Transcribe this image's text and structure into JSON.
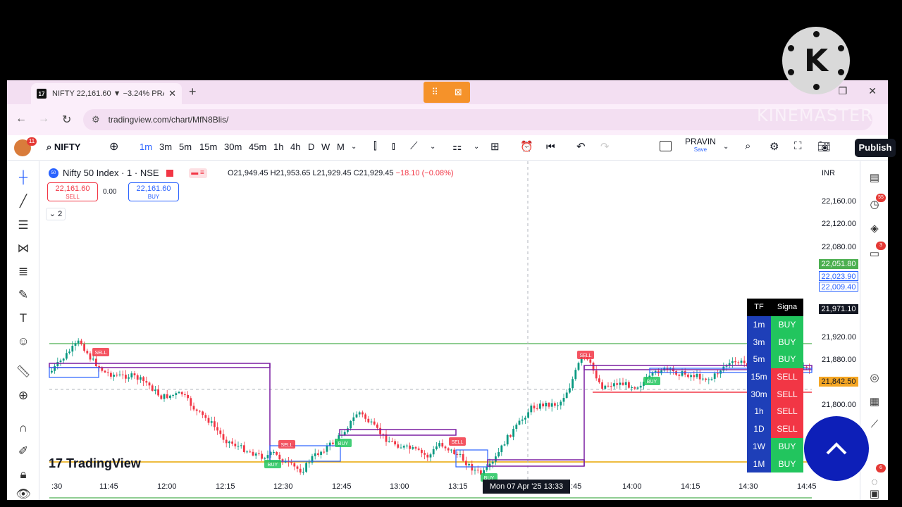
{
  "browser": {
    "tab_title": "NIFTY 22,161.60 ▼ −3.24% PRA",
    "url": "tradingview.com/chart/MfN8Blis/",
    "tab_close": "✕",
    "new_tab": "+",
    "win_restore": "❐",
    "win_close": "✕"
  },
  "overlay": {
    "logo_letter": "K",
    "watermark": "KINEMASTER"
  },
  "header": {
    "symbol": "NIFTY",
    "timeframes": [
      "1m",
      "3m",
      "5m",
      "15m",
      "30m",
      "45m",
      "1h",
      "4h",
      "D",
      "W",
      "M"
    ],
    "active_timeframe": "1m",
    "layout_name": "PRAVIN",
    "layout_sub": "Save",
    "publish_label": "Publish"
  },
  "legend": {
    "title": "Nifty 50 Index · 1 · NSE",
    "symbol_badge": "50",
    "o": "O21,949.45",
    "h": "H21,953.65",
    "l": "L21,929.45",
    "c": "C21,929.45",
    "chg": "−18.10 (−0.08%)",
    "sell_price": "22,161.60",
    "sell_label": "SELL",
    "buy_price": "22,161.60",
    "buy_label": "BUY",
    "spread": "0.00",
    "indicator_count": "2"
  },
  "price_axis": {
    "currency": "INR",
    "labels": [
      "22,160.00",
      "22,120.00",
      "22,080.00",
      "21,920.00",
      "21,880.00",
      "21,800.00"
    ],
    "tags": [
      {
        "text": "22,051.80",
        "bg": "#4caf50",
        "fg": "#ffffff"
      },
      {
        "text": "22,023.90",
        "bg": "#ffffff",
        "fg": "#2962ff"
      },
      {
        "text": "22,009.40",
        "bg": "#ffffff",
        "fg": "#2962ff"
      },
      {
        "text": "21,971.10",
        "bg": "#131722",
        "fg": "#ffffff"
      },
      {
        "text": "21,842.50",
        "bg": "#f5a623",
        "fg": "#131722"
      }
    ]
  },
  "time_axis": {
    "labels": [
      ":30",
      "11:45",
      "12:00",
      "12:15",
      "12:30",
      "12:45",
      "13:00",
      "13:15",
      ":45",
      "14:00",
      "14:15",
      "14:30",
      "14:45"
    ],
    "crosshair": "Mon 07 Apr '25   13:33"
  },
  "signals": {
    "header_tf": "TF",
    "header_sig": "Signa",
    "rows": [
      {
        "tf": "1m",
        "signal": "BUY"
      },
      {
        "tf": "3m",
        "signal": "BUY"
      },
      {
        "tf": "5m",
        "signal": "BUY"
      },
      {
        "tf": "15m",
        "signal": "SELL"
      },
      {
        "tf": "30m",
        "signal": "SELL"
      },
      {
        "tf": "1h",
        "signal": "SELL"
      },
      {
        "tf": "1D",
        "signal": "SELL"
      },
      {
        "tf": "1W",
        "signal": "BUY"
      },
      {
        "tf": "1M",
        "signal": "BUY"
      }
    ],
    "buy_color": "#22c55e",
    "sell_color": "#f23645"
  },
  "chart_labels": {
    "sell": "SELL",
    "buy": "BUY"
  },
  "watermark_logo": "TradingView",
  "badges": {
    "avatar": "11",
    "alerts": "55",
    "chat": "3",
    "bottom": "6"
  },
  "fab_icon": "chevron-up"
}
